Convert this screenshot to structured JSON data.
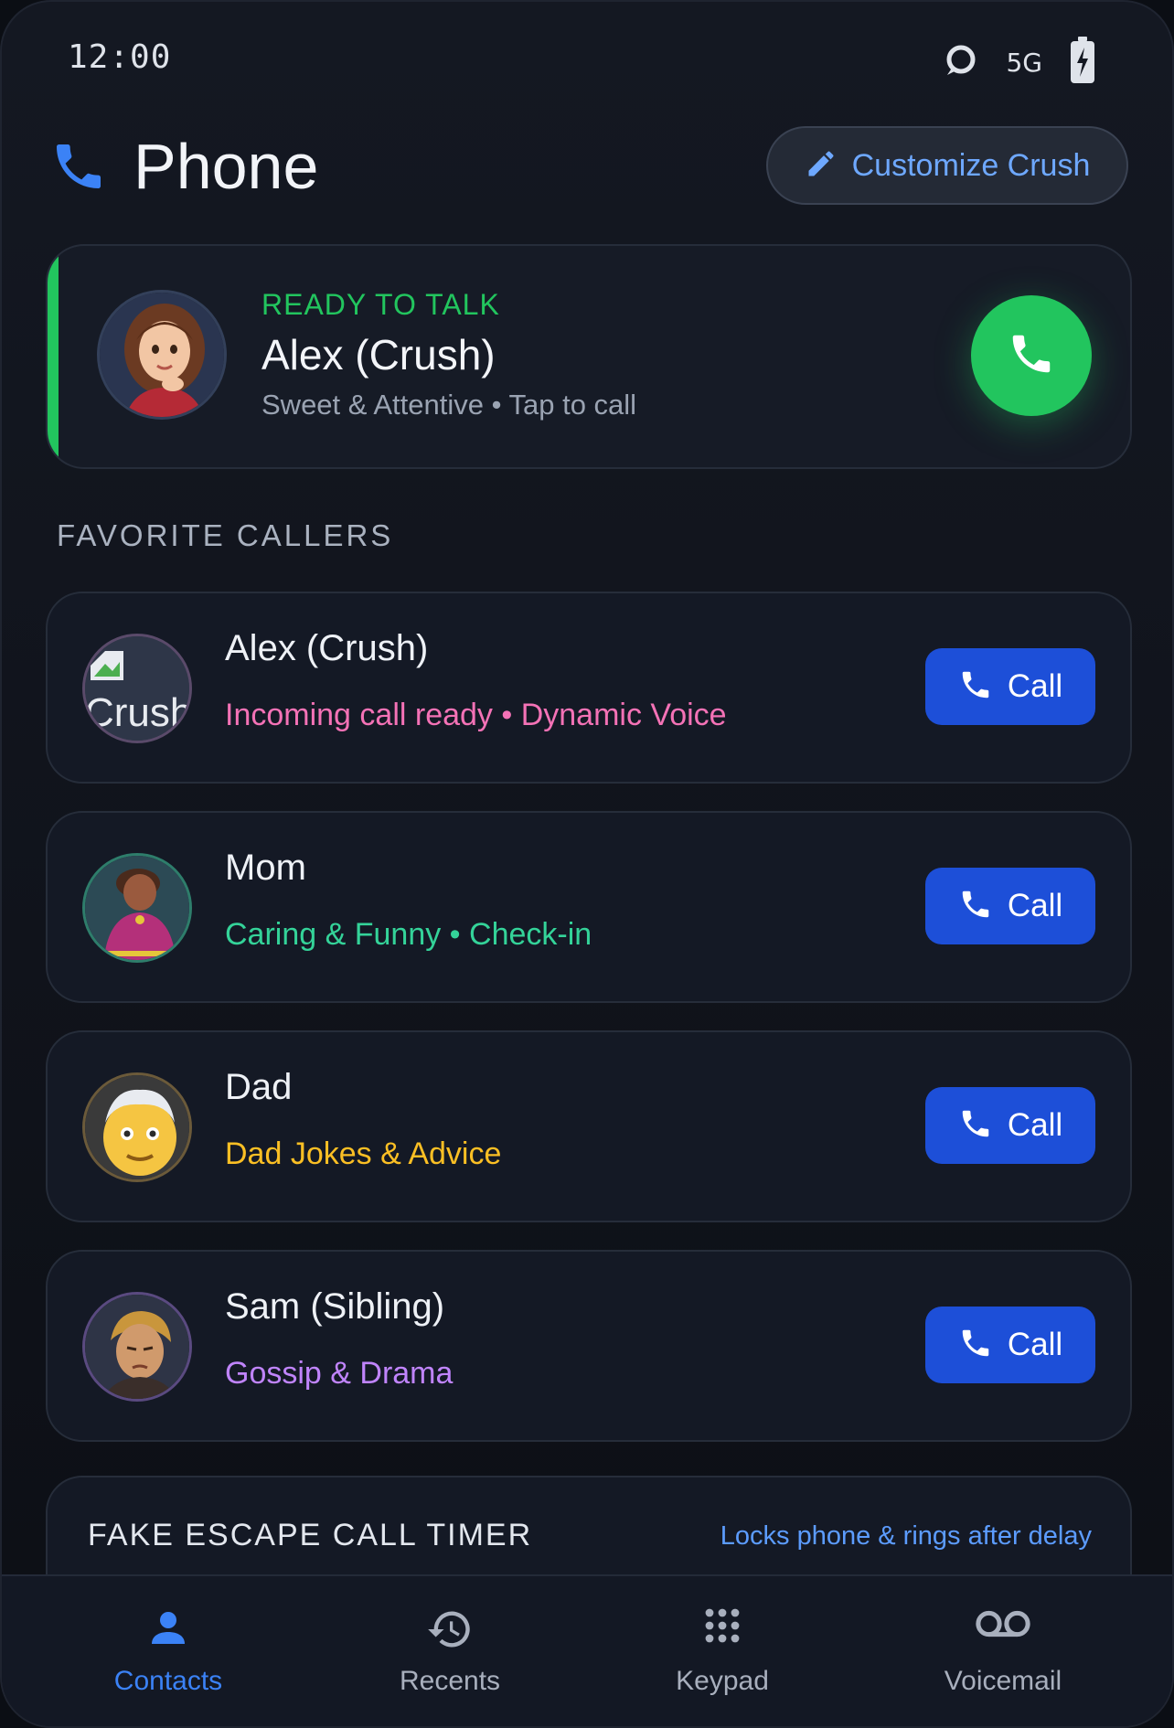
{
  "status_bar": {
    "time": "12:00",
    "network": "5G",
    "icons": [
      "sync-circle-icon",
      "battery-charging-icon"
    ]
  },
  "header": {
    "title": "Phone",
    "icon": "phone-icon",
    "customize_label": "Customize Crush",
    "customize_icon": "pencil-icon"
  },
  "hero": {
    "status": "READY TO TALK",
    "name": "Alex (Crush)",
    "subtitle": "Sweet & Attentive • Tap to call",
    "accent": "#22c55e"
  },
  "favorites": {
    "section_title": "FAVORITE CALLERS",
    "call_label": "Call",
    "items": [
      {
        "name": "Alex (Crush)",
        "description": "Incoming call ready • Dynamic Voice",
        "color": "#f472b6",
        "avatar_alt": "Crush"
      },
      {
        "name": "Mom",
        "description": "Caring & Funny • Check-in",
        "color": "#34d399"
      },
      {
        "name": "Dad",
        "description": "Dad Jokes & Advice",
        "color": "#fbbf24"
      },
      {
        "name": "Sam (Sibling)",
        "description": "Gossip & Drama",
        "color": "#c084fc"
      }
    ]
  },
  "escape_timer": {
    "title": "FAKE ESCAPE CALL TIMER",
    "hint": "Locks phone & rings after delay"
  },
  "bottom_nav": {
    "items": [
      {
        "label": "Contacts",
        "icon": "person-icon",
        "active": true
      },
      {
        "label": "Recents",
        "icon": "history-icon",
        "active": false
      },
      {
        "label": "Keypad",
        "icon": "keypad-icon",
        "active": false
      },
      {
        "label": "Voicemail",
        "icon": "voicemail-icon",
        "active": false
      }
    ]
  }
}
